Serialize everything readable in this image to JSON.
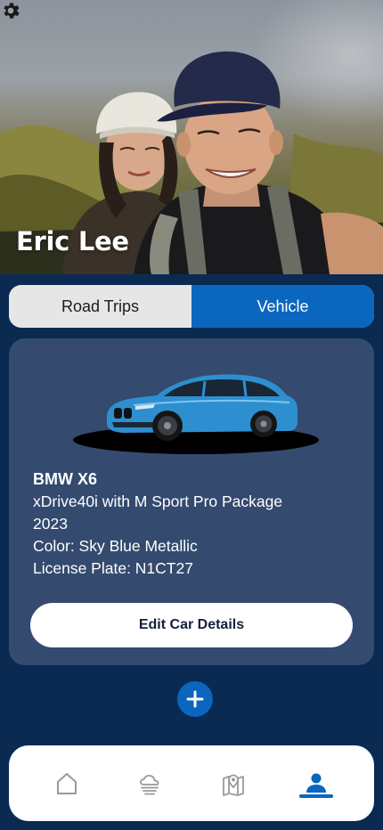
{
  "profile": {
    "name": "Eric Lee",
    "settings_icon": "gear-icon"
  },
  "tabs": [
    {
      "label": "Road Trips",
      "active": false
    },
    {
      "label": "Vehicle",
      "active": true
    }
  ],
  "vehicle": {
    "model": "BMW X6",
    "trim": "xDrive40i with M Sport Pro Package",
    "year": "2023",
    "color": "Color: Sky Blue Metallic",
    "plate": "License Plate: N1CT27",
    "car_color": "#2e8fd0",
    "edit_label": "Edit Car Details"
  },
  "add_button": {
    "icon": "plus-icon"
  },
  "bottom_nav": [
    {
      "icon": "home-icon",
      "active": false
    },
    {
      "icon": "weather-icon",
      "active": false
    },
    {
      "icon": "map-pin-icon",
      "active": false
    },
    {
      "icon": "profile-icon",
      "active": true
    }
  ],
  "colors": {
    "background": "#0b2a52",
    "card": "#344a6e",
    "accent": "#0a66bf",
    "nav_inactive": "#9a9a9a"
  }
}
